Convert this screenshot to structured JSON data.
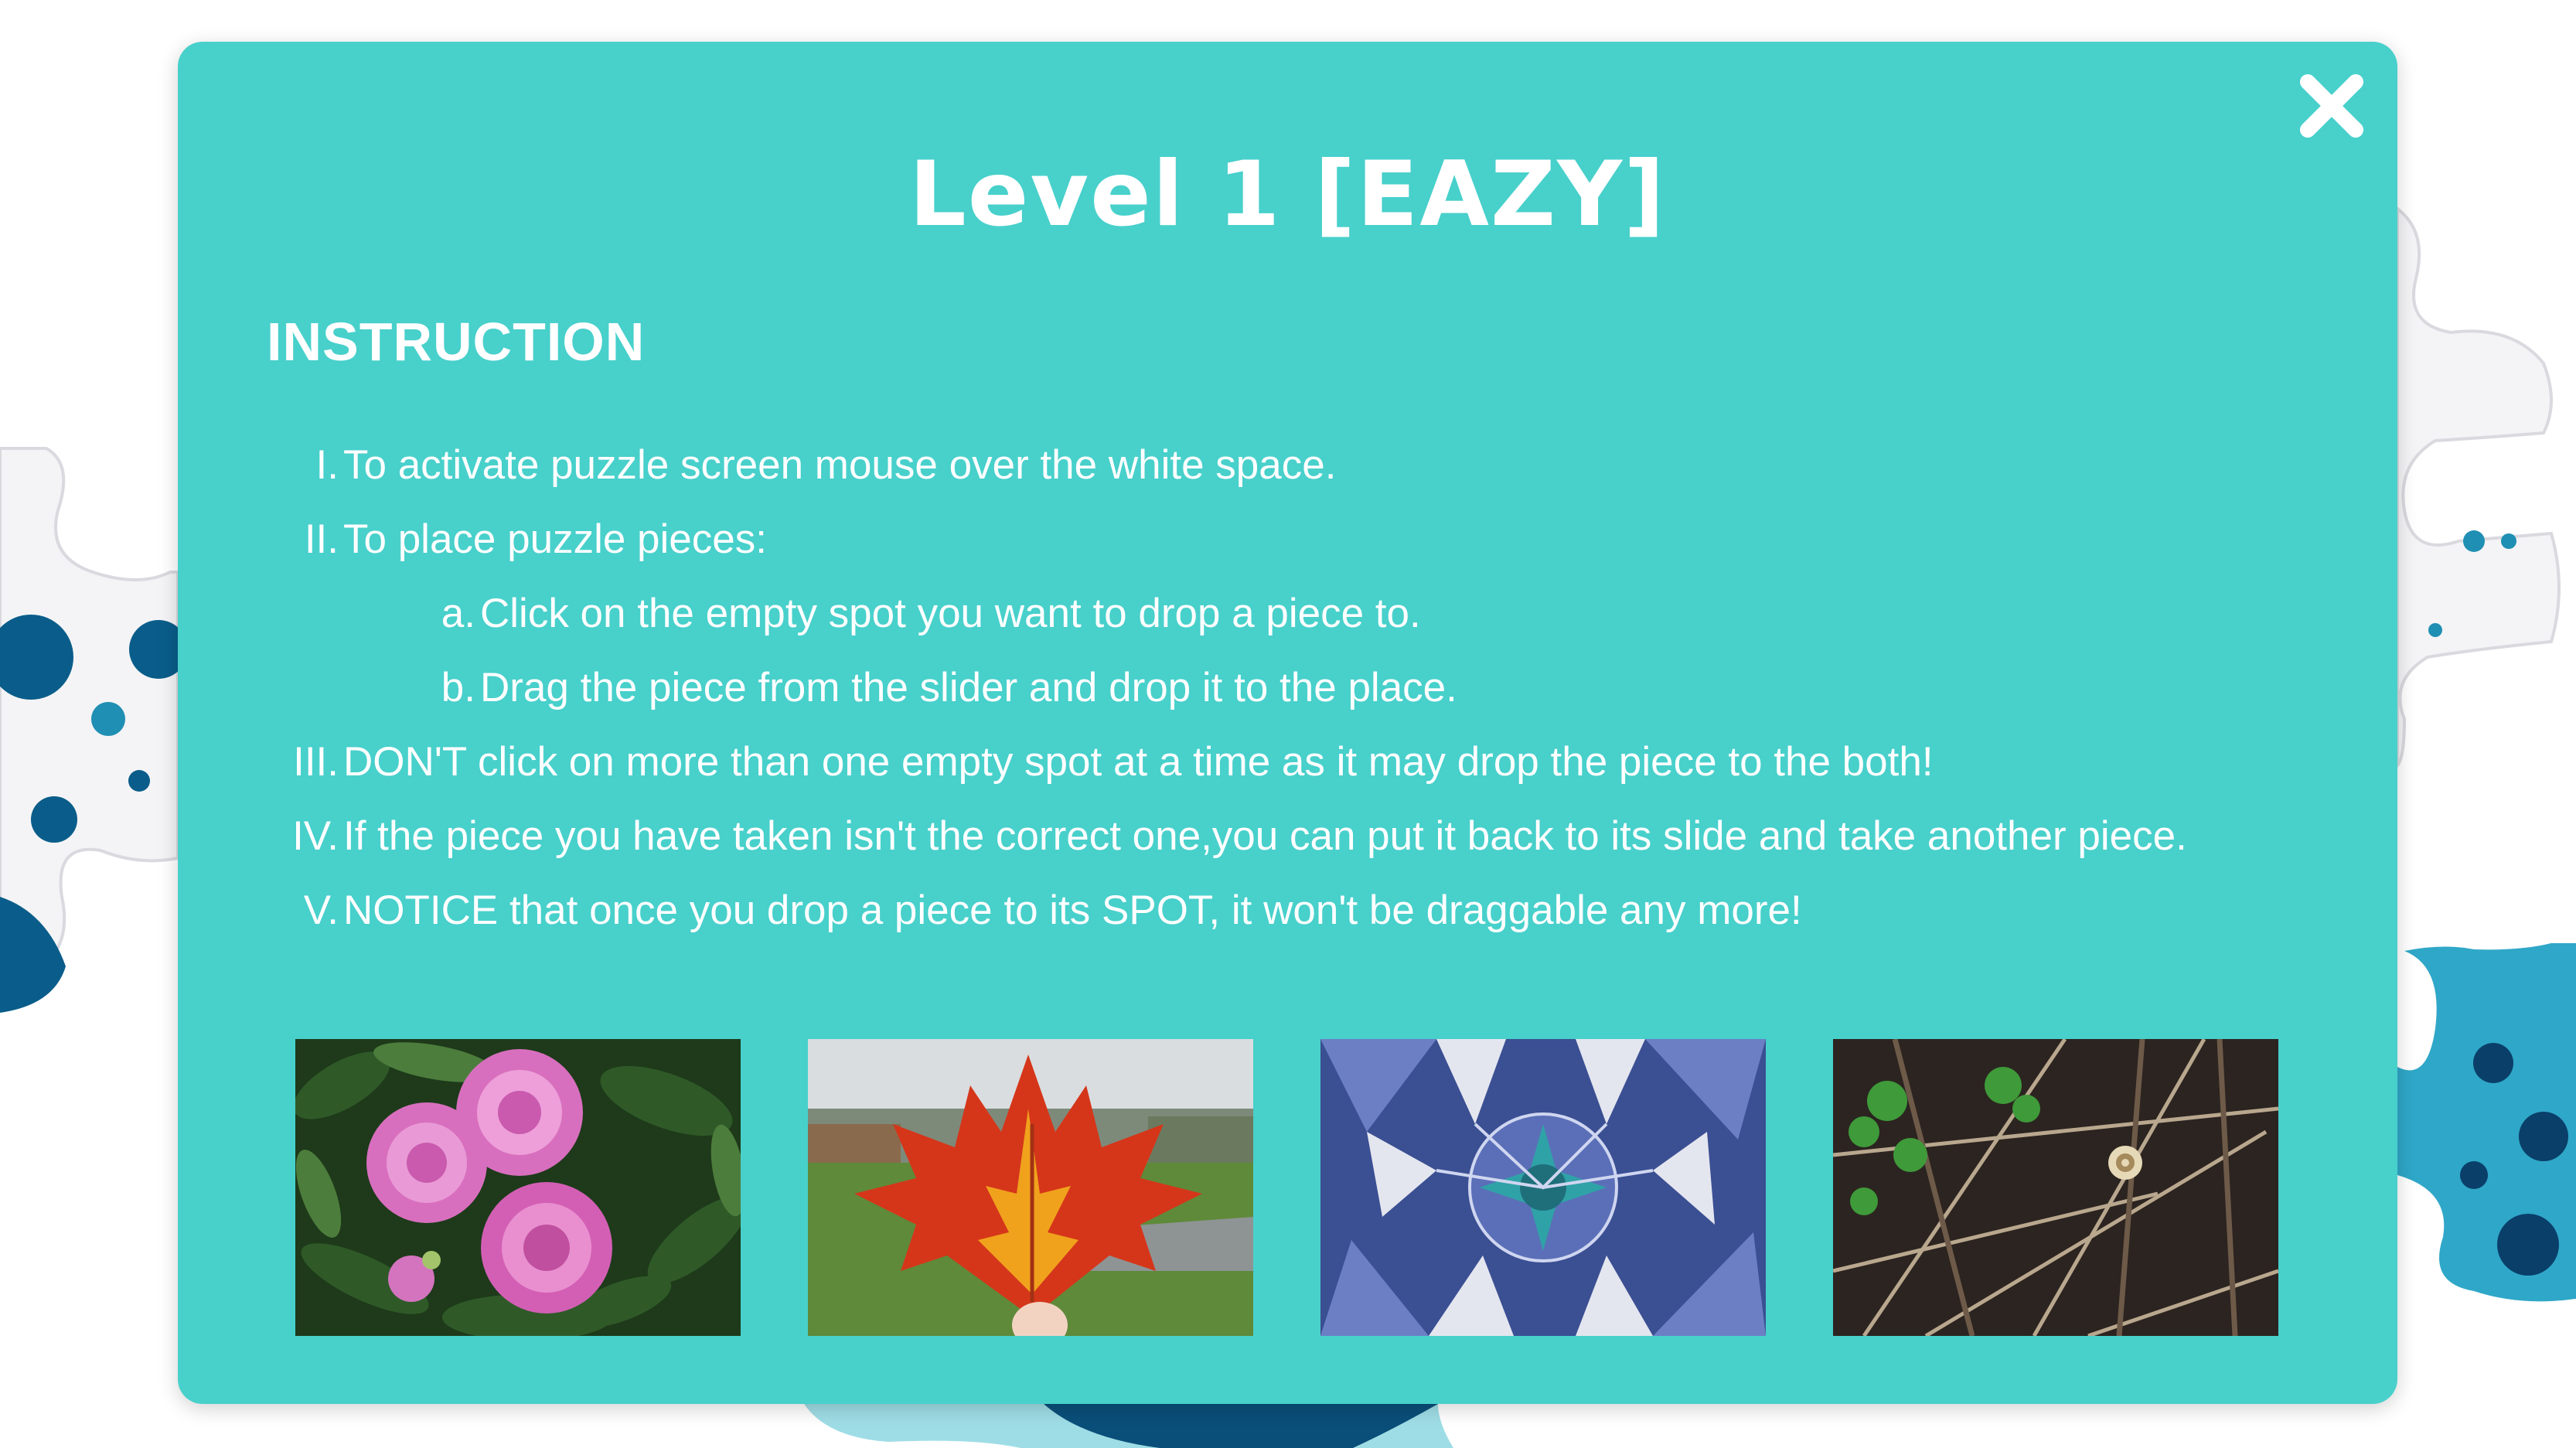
{
  "modal": {
    "title": "Level 1 [EAZY]",
    "heading": "INSTRUCTION",
    "close_icon": "close-icon",
    "steps": [
      {
        "num": "I.",
        "text": "To activate puzzle screen mouse over the white space."
      },
      {
        "num": "II.",
        "text": "To place puzzle pieces:"
      },
      {
        "num": "a.",
        "text": "Click on the empty spot you want to drop a piece to."
      },
      {
        "num": "b.",
        "text": "Drag the piece from the slider and drop it to the place."
      },
      {
        "num": "III.",
        "text": "DON'T click on more than one empty spot at a time as it may drop the piece to the both!"
      },
      {
        "num": "IV.",
        "text": "If the piece you have taken isn't the correct one,you can put it back to its slide and take another piece."
      },
      {
        "num": "V.",
        "text": "NOTICE that once you drop a piece to its SPOT, it won't be draggable any more!"
      }
    ],
    "images": [
      "peony-flowers-image",
      "maple-leaf-image",
      "mosaic-dome-image",
      "forest-floor-snail-image"
    ]
  },
  "colors": {
    "modal_bg": "#48d0cb",
    "text": "#ffffff",
    "decor_dark": "#0a5d8a",
    "decor_mid": "#1f8fb3"
  }
}
